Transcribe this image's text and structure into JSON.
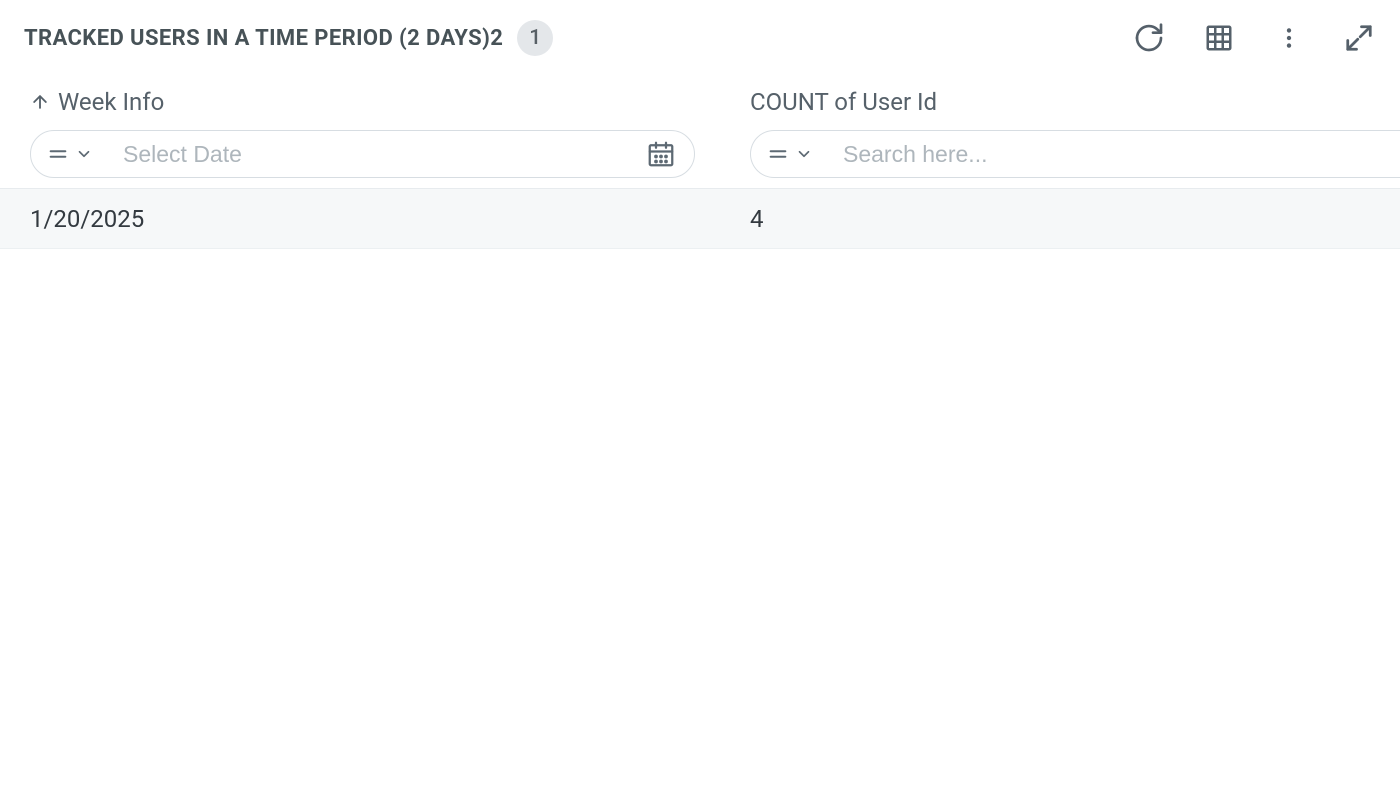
{
  "header": {
    "title": "TRACKED USERS IN A TIME PERIOD (2 DAYS)2",
    "badge_count": "1",
    "icons": {
      "refresh": "refresh-icon",
      "table": "table-icon",
      "more": "more-vertical-icon",
      "fullscreen": "fullscreen-icon"
    }
  },
  "columns": [
    {
      "label": "Week Info",
      "sort": "asc",
      "filter_placeholder": "Select Date",
      "filter_value": "",
      "has_calendar": true
    },
    {
      "label": "COUNT of User Id",
      "sort": "none",
      "filter_placeholder": "Search here...",
      "filter_value": "",
      "has_calendar": false
    }
  ],
  "rows": [
    {
      "week_info": "1/20/2025",
      "count_user_id": "4"
    }
  ]
}
